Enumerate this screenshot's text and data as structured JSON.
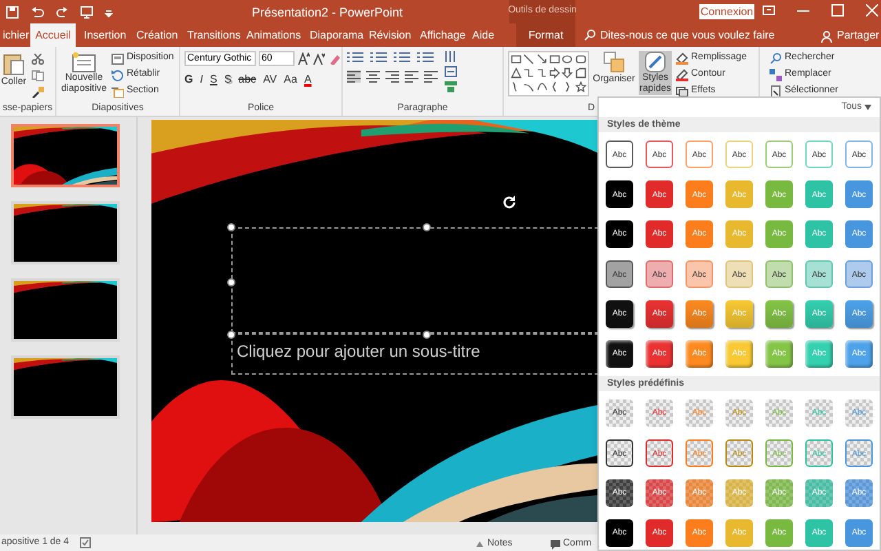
{
  "window": {
    "title": "Présentation2 - PowerPoint",
    "context_group": "Outils de dessin",
    "signin": "Connexion"
  },
  "tabs": [
    {
      "label": "ichier",
      "selected": false
    },
    {
      "label": "Accueil",
      "selected": true
    },
    {
      "label": "Insertion",
      "selected": false
    },
    {
      "label": "Création",
      "selected": false
    },
    {
      "label": "Transitions",
      "selected": false
    },
    {
      "label": "Animations",
      "selected": false
    },
    {
      "label": "Diaporama",
      "selected": false
    },
    {
      "label": "Révision",
      "selected": false
    },
    {
      "label": "Affichage",
      "selected": false
    },
    {
      "label": "Aide",
      "selected": false
    },
    {
      "label": "Format",
      "selected": false
    }
  ],
  "tell_me": {
    "placeholder": "Dites-nous ce que vous voulez faire"
  },
  "share": "Partager",
  "ribbon": {
    "clipboard": {
      "label": "sse-papiers",
      "paste": "Coller"
    },
    "slides": {
      "label": "Diapositives",
      "new_slide": [
        "Nouvelle",
        "diapositive"
      ],
      "items": [
        "Disposition",
        "Rétablir",
        "Section"
      ]
    },
    "font": {
      "label": "Police",
      "font_name": "Century Gothic",
      "font_size": "60",
      "formats": [
        "G",
        "I",
        "S",
        "S",
        "abc",
        "AV",
        "Aa",
        "A"
      ]
    },
    "paragraph": {
      "label": "Paragraphe"
    },
    "drawing": {
      "label": "D",
      "arrange": "Organiser",
      "quick_styles": [
        "Styles",
        "rapides"
      ],
      "quick_styles_pressed": true,
      "items": [
        "Remplissage",
        "Contour",
        "Effets"
      ]
    },
    "editing": {
      "items": [
        "Rechercher",
        "Remplacer",
        "Sélectionner"
      ]
    }
  },
  "thumbnails": [
    {
      "selected": true
    },
    {
      "selected": false
    },
    {
      "selected": false
    },
    {
      "selected": false
    }
  ],
  "slide": {
    "subtitle_placeholder": "Cliquez pour ajouter un sous-titre"
  },
  "status_bar": {
    "slide_counter": "apositive 1 de 4",
    "notes": "Notes",
    "comments": "Comm"
  },
  "styles_gallery": {
    "filter": "Tous",
    "sections": [
      {
        "title": "Styles de thème",
        "rows": [
          {
            "kind": "outline",
            "tiles": [
              {
                "label": "Abc",
                "color": "#595959"
              },
              {
                "label": "Abc",
                "color": "#e8575a"
              },
              {
                "label": "Abc",
                "color": "#f9a36b"
              },
              {
                "label": "Abc",
                "color": "#edd47a"
              },
              {
                "label": "Abc",
                "color": "#9ccf73"
              },
              {
                "label": "Abc",
                "color": "#6fd8c2"
              },
              {
                "label": "Abc",
                "color": "#7fb5ea"
              }
            ]
          },
          {
            "kind": "solid",
            "tiles": [
              {
                "label": "Abc",
                "color": "#000000"
              },
              {
                "label": "Abc",
                "color": "#e12b2b"
              },
              {
                "label": "Abc",
                "color": "#fb7d1c"
              },
              {
                "label": "Abc",
                "color": "#e8b92e"
              },
              {
                "label": "Abc",
                "color": "#78b940"
              },
              {
                "label": "Abc",
                "color": "#2ec3a4"
              },
              {
                "label": "Abc",
                "color": "#4896dd"
              }
            ]
          },
          {
            "kind": "plain",
            "tiles": [
              {
                "label": "Abc",
                "color": "#000000"
              },
              {
                "label": "Abc",
                "color": "#e12b2b"
              },
              {
                "label": "Abc",
                "color": "#fb7d1c"
              },
              {
                "label": "Abc",
                "color": "#e8b92e"
              },
              {
                "label": "Abc",
                "color": "#78b940"
              },
              {
                "label": "Abc",
                "color": "#2ec3a4"
              },
              {
                "label": "Abc",
                "color": "#4896dd"
              }
            ]
          },
          {
            "kind": "light",
            "tiles": [
              {
                "label": "Abc",
                "color": "#555555"
              },
              {
                "label": "Abc",
                "color": "#e06a6c"
              },
              {
                "label": "Abc",
                "color": "#f59566"
              },
              {
                "label": "Abc",
                "color": "#e1c47a"
              },
              {
                "label": "Abc",
                "color": "#8ec26a"
              },
              {
                "label": "Abc",
                "color": "#5fc8b2"
              },
              {
                "label": "Abc",
                "color": "#6c9fdc"
              }
            ]
          },
          {
            "kind": "gradient",
            "tiles": [
              {
                "label": "Abc",
                "color": "#111111"
              },
              {
                "label": "Abc",
                "color": "#ea3232"
              },
              {
                "label": "Abc",
                "color": "#fd8a20"
              },
              {
                "label": "Abc",
                "color": "#f8c934"
              },
              {
                "label": "Abc",
                "color": "#84c547"
              },
              {
                "label": "Abc",
                "color": "#34d0b0"
              },
              {
                "label": "Abc",
                "color": "#4ea2ea"
              }
            ]
          },
          {
            "kind": "bevel",
            "tiles": [
              {
                "label": "Abc",
                "color": "#111111"
              },
              {
                "label": "Abc",
                "color": "#ea3232"
              },
              {
                "label": "Abc",
                "color": "#fd8a20"
              },
              {
                "label": "Abc",
                "color": "#f8c934"
              },
              {
                "label": "Abc",
                "color": "#84c547"
              },
              {
                "label": "Abc",
                "color": "#34d0b0"
              },
              {
                "label": "Abc",
                "color": "#4ea2ea"
              }
            ]
          }
        ]
      },
      {
        "title": "Styles prédéfinis",
        "rows": [
          {
            "kind": "checker",
            "tiles": [
              {
                "label": "Abc",
                "color": "#333333"
              },
              {
                "label": "Abc",
                "color": "#e12b2b"
              },
              {
                "label": "Abc",
                "color": "#fb7d1c"
              },
              {
                "label": "Abc",
                "color": "#b88a10"
              },
              {
                "label": "Abc",
                "color": "#78b940"
              },
              {
                "label": "Abc",
                "color": "#2ec3a4"
              },
              {
                "label": "Abc",
                "color": "#4896dd"
              }
            ]
          },
          {
            "kind": "checker_outline",
            "tiles": [
              {
                "label": "Abc",
                "color": "#333333"
              },
              {
                "label": "Abc",
                "color": "#e12b2b"
              },
              {
                "label": "Abc",
                "color": "#fb7d1c"
              },
              {
                "label": "Abc",
                "color": "#b88a10"
              },
              {
                "label": "Abc",
                "color": "#78b940"
              },
              {
                "label": "Abc",
                "color": "#2ec3a4"
              },
              {
                "label": "Abc",
                "color": "#4896dd"
              }
            ]
          },
          {
            "kind": "checker_tint",
            "tiles": [
              {
                "label": "Abc",
                "color": "#404040"
              },
              {
                "label": "Abc",
                "color": "#d84848"
              },
              {
                "label": "Abc",
                "color": "#e8883c"
              },
              {
                "label": "Abc",
                "color": "#d8b448"
              },
              {
                "label": "Abc",
                "color": "#80b850"
              },
              {
                "label": "Abc",
                "color": "#48bca4"
              },
              {
                "label": "Abc",
                "color": "#5c98d8"
              }
            ]
          },
          {
            "kind": "plain",
            "tiles": [
              {
                "label": "Abc",
                "color": "#000000"
              },
              {
                "label": "Abc",
                "color": "#e12b2b"
              },
              {
                "label": "Abc",
                "color": "#fb7d1c"
              },
              {
                "label": "Abc",
                "color": "#e8b92e"
              },
              {
                "label": "Abc",
                "color": "#78b940"
              },
              {
                "label": "Abc",
                "color": "#2ec3a4"
              },
              {
                "label": "Abc",
                "color": "#4896dd"
              }
            ]
          }
        ]
      }
    ]
  }
}
